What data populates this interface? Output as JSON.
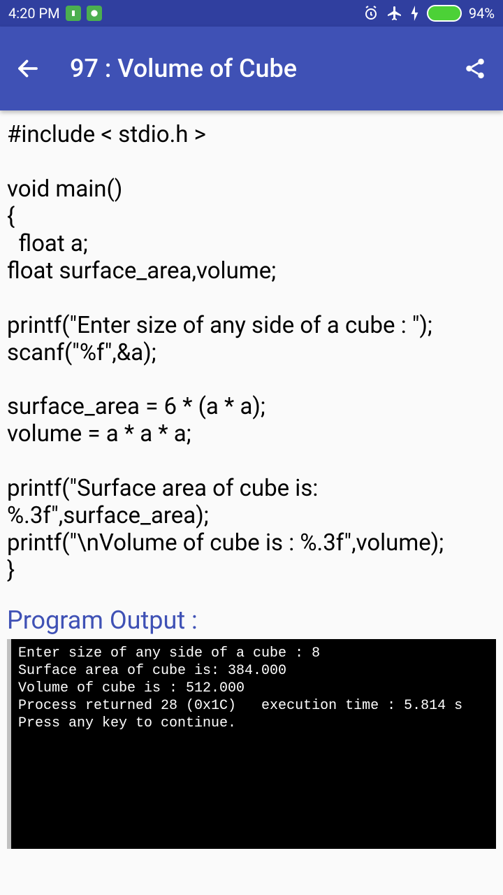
{
  "status": {
    "time": "4:20 PM",
    "battery_pct": "94%"
  },
  "appbar": {
    "title": "97 : Volume of Cube"
  },
  "code": "#include < stdio.h >\n\nvoid main()\n{\n  float a;\nfloat surface_area,volume;\n\nprintf(\"Enter size of any side of a cube : \");\nscanf(\"%f\",&a);\n\nsurface_area = 6 * (a * a);\nvolume = a * a * a;\n\nprintf(\"Surface area of cube is: %.3f\",surface_area);\nprintf(\"\\nVolume of cube is : %.3f\",volume);\n}",
  "output_heading": "Program Output :",
  "console": "Enter size of any side of a cube : 8\nSurface area of cube is: 384.000\nVolume of cube is : 512.000\nProcess returned 28 (0x1C)   execution time : 5.814 s\nPress any key to continue."
}
